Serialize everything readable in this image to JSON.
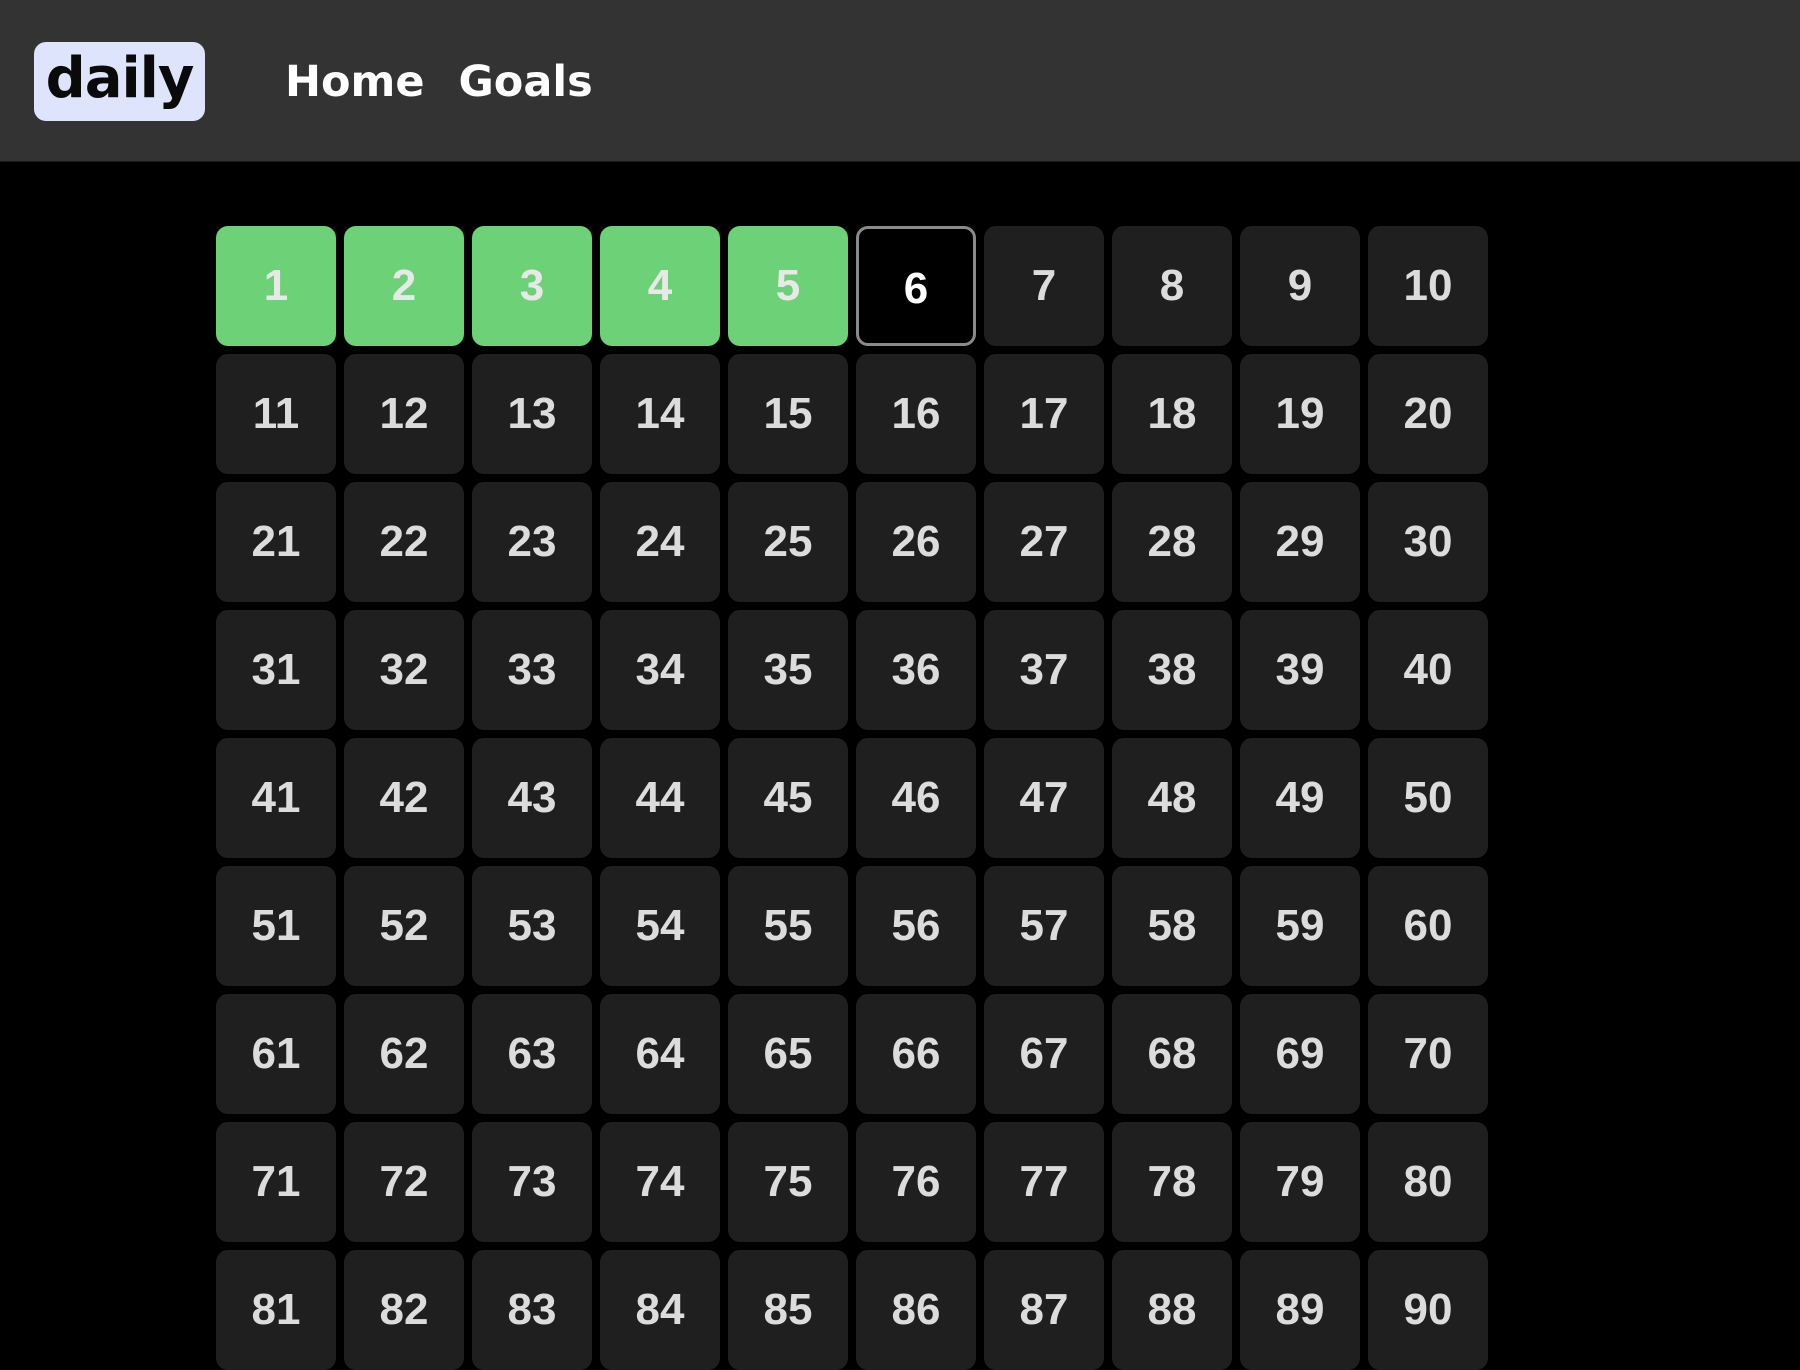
{
  "header": {
    "logo_text": "daily",
    "nav": [
      {
        "label": "Home"
      },
      {
        "label": "Goals"
      }
    ]
  },
  "colors": {
    "header_bg": "#333333",
    "page_bg": "#000000",
    "logo_bg": "#dde4fb",
    "tile_bg": "#1f1f1f",
    "tile_done": "#6dd177",
    "tile_current_border": "#8a8a8a"
  },
  "tracker": {
    "completed_days": [
      1,
      2,
      3,
      4,
      5
    ],
    "current_day": 6,
    "days": [
      "1",
      "2",
      "3",
      "4",
      "5",
      "6",
      "7",
      "8",
      "9",
      "10",
      "11",
      "12",
      "13",
      "14",
      "15",
      "16",
      "17",
      "18",
      "19",
      "20",
      "21",
      "22",
      "23",
      "24",
      "25",
      "26",
      "27",
      "28",
      "29",
      "30",
      "31",
      "32",
      "33",
      "34",
      "35",
      "36",
      "37",
      "38",
      "39",
      "40",
      "41",
      "42",
      "43",
      "44",
      "45",
      "46",
      "47",
      "48",
      "49",
      "50",
      "51",
      "52",
      "53",
      "54",
      "55",
      "56",
      "57",
      "58",
      "59",
      "60",
      "61",
      "62",
      "63",
      "64",
      "65",
      "66",
      "67",
      "68",
      "69",
      "70",
      "71",
      "72",
      "73",
      "74",
      "75",
      "76",
      "77",
      "78",
      "79",
      "80",
      "81",
      "82",
      "83",
      "84",
      "85",
      "86",
      "87",
      "88",
      "89",
      "90"
    ]
  }
}
